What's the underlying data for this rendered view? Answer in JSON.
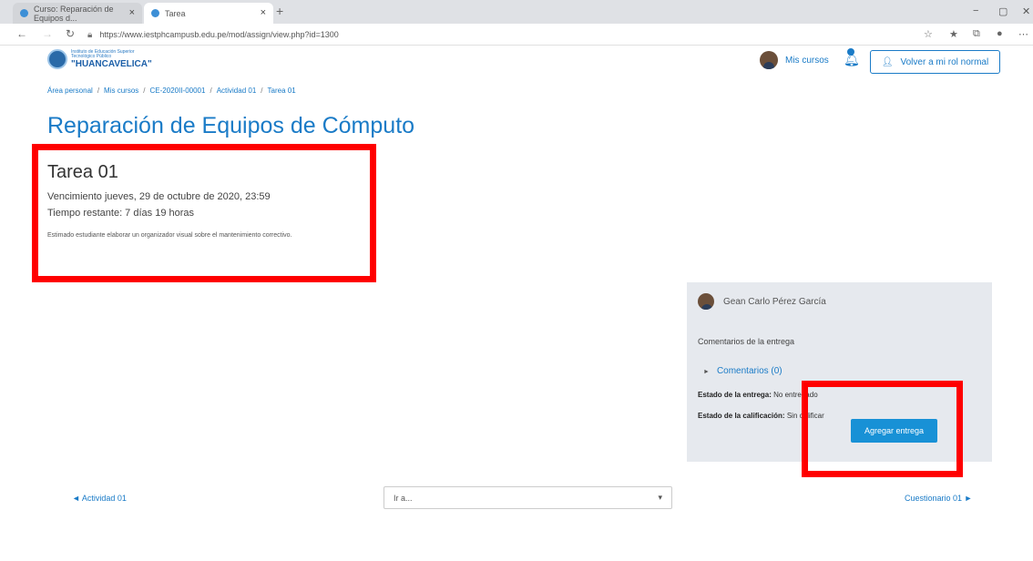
{
  "browser": {
    "tabs": [
      {
        "title": "Curso: Reparación de Equipos d..."
      },
      {
        "title": "Tarea"
      }
    ],
    "tab_close": "×",
    "new_tab": "+",
    "url": "https://www.iestphcampusb.edu.pe/mod/assign/view.php?id=1300",
    "window_controls": [
      "−",
      "▢",
      "✕"
    ]
  },
  "header": {
    "logo_line1": "Instituto de Educación Superior",
    "logo_line2": "Tecnológico Público",
    "logo_name": "\"HUANCAVELICA\"",
    "my_courses": "Mis cursos",
    "role_button": "Volver a mi rol normal"
  },
  "breadcrumb": [
    "Área personal",
    "Mis cursos",
    "CE-2020II-00001",
    "Actividad 01",
    "Tarea 01"
  ],
  "course_title": "Reparación de Equipos de Cómputo",
  "assignment": {
    "name": "Tarea 01",
    "due": "Vencimiento jueves, 29 de octubre de 2020, 23:59",
    "remaining": "Tiempo restante: 7 días 19 horas",
    "intro": "Estimado estudiante elaborar un organizador visual sobre el mantenimiento correctivo."
  },
  "submission": {
    "student": "Gean Carlo Pérez García",
    "comments_heading": "Comentarios de la entrega",
    "comments_link": "Comentarios (0)",
    "status_label": "Estado de la entrega:",
    "status_value": "No entregado",
    "grade_label": "Estado de la calificación:",
    "grade_value": "Sin calificar",
    "add_button": "Agregar entrega"
  },
  "footer_nav": {
    "prev": "◄ Actividad 01",
    "jump_placeholder": "Ir a...",
    "next": "Cuestionario 01 ►"
  }
}
